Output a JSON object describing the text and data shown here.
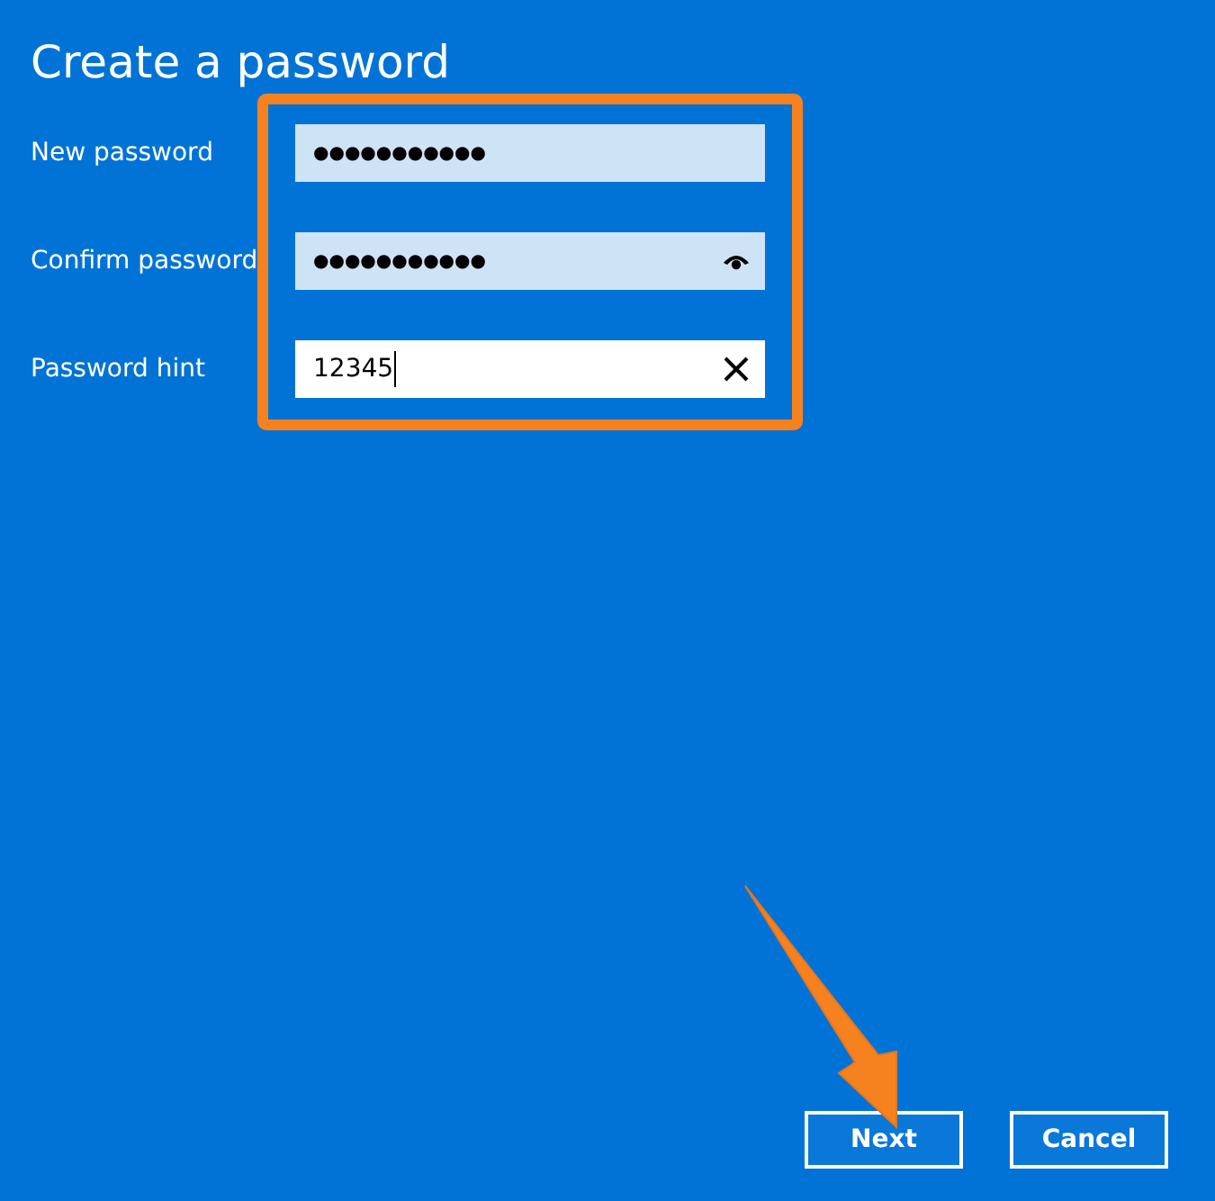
{
  "title": "Create a password",
  "fields": [
    {
      "label": "New password",
      "kind": "password",
      "value": "●●●●●●●●●●●",
      "focused": false,
      "reveal_icon": false,
      "clear_icon": false
    },
    {
      "label": "Confirm password",
      "kind": "password",
      "value": "●●●●●●●●●●●",
      "focused": false,
      "reveal_icon": true,
      "clear_icon": false
    },
    {
      "label": "Password hint",
      "kind": "text",
      "value": "12345",
      "focused": true,
      "reveal_icon": false,
      "clear_icon": true
    }
  ],
  "buttons": [
    {
      "label": "Next"
    },
    {
      "label": "Cancel"
    }
  ]
}
